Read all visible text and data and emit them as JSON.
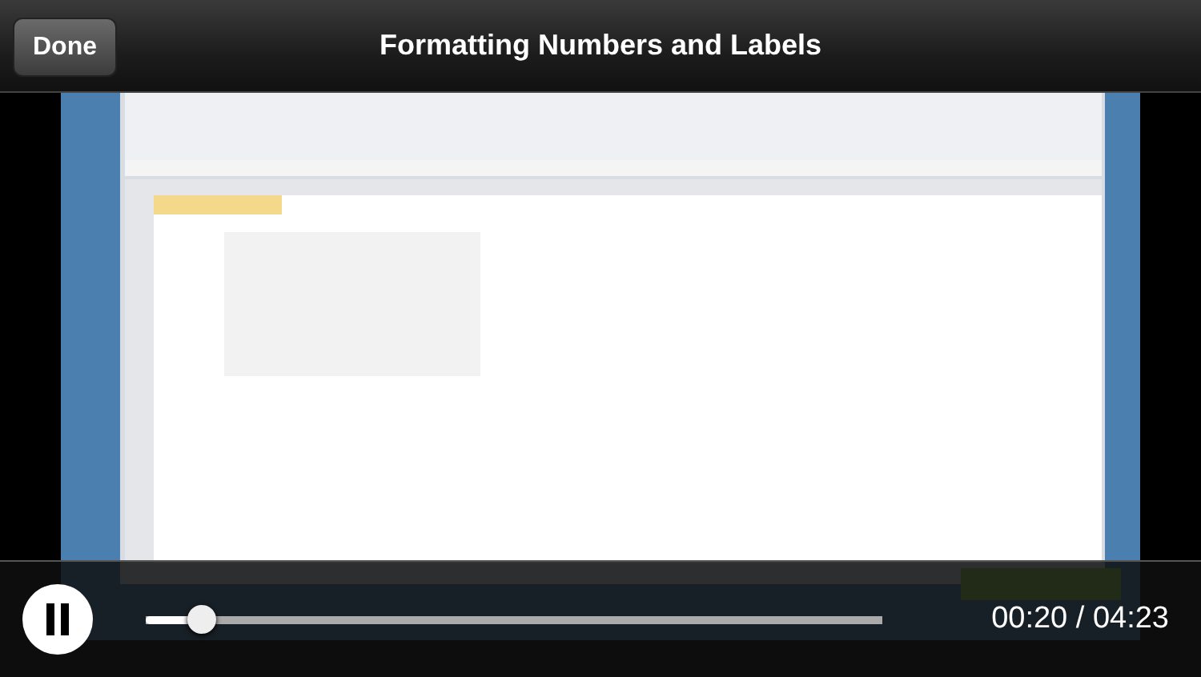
{
  "top_bar": {
    "done_button": "Done",
    "title": "Formatting Numbers and Labels"
  },
  "controls": {
    "playing": true,
    "progress": {
      "level": 0.076
    },
    "time": "00:20 / 04:23"
  }
}
